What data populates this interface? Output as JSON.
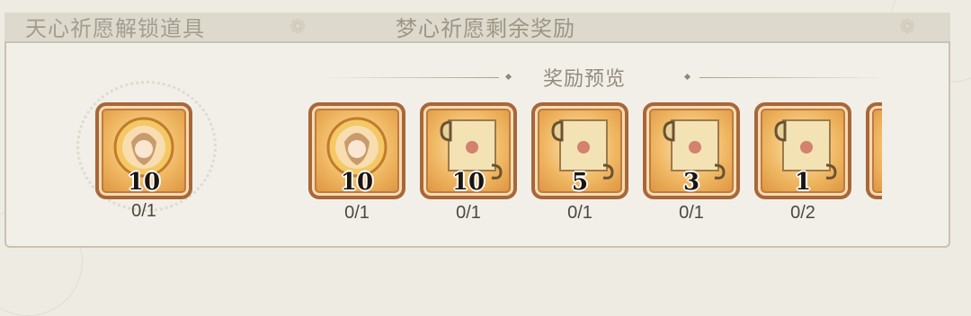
{
  "header": {
    "left_title": "天心祈愿解锁道具",
    "center_title": "梦心祈愿剩余奖励"
  },
  "preview_title": "奖励预览",
  "unlock_item": {
    "icon": "character-medal-icon",
    "count": "10",
    "progress": "0/1"
  },
  "rewards": [
    {
      "icon": "character-medal-icon",
      "count": "10",
      "progress": "0/1"
    },
    {
      "icon": "scroll-icon",
      "count": "10",
      "progress": "0/1"
    },
    {
      "icon": "scroll-icon",
      "count": "5",
      "progress": "0/1"
    },
    {
      "icon": "scroll-icon",
      "count": "3",
      "progress": "0/1"
    },
    {
      "icon": "scroll-icon",
      "count": "1",
      "progress": "0/2"
    }
  ],
  "colors": {
    "frame": "#a8673a",
    "tile": "#efb661",
    "panel": "#f2efe8",
    "header": "#dddacd"
  }
}
